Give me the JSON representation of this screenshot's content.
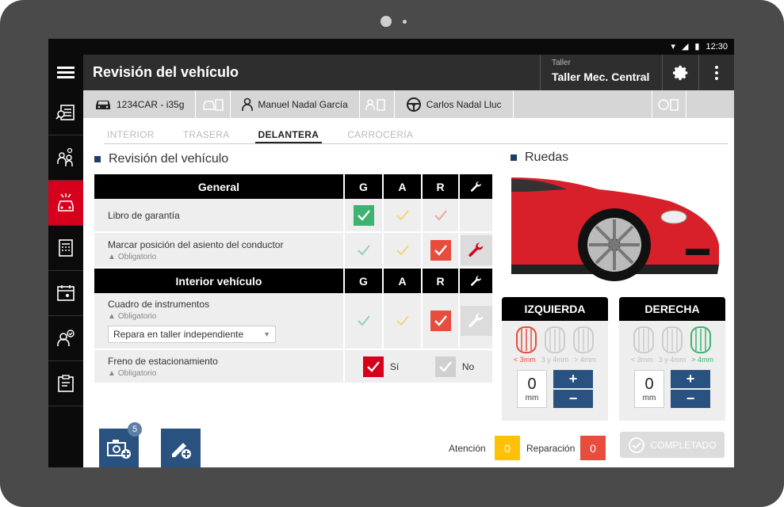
{
  "status_bar": {
    "time": "12:30"
  },
  "app_bar": {
    "title": "Revisión del vehículo",
    "taller_label": "Taller",
    "taller_value": "Taller Mec. Central"
  },
  "info_bar": {
    "plate": "1234CAR - i35g",
    "owner": "Manuel Nadal García",
    "driver": "Carlos Nadal Lluc"
  },
  "tabs": [
    "INTERIOR",
    "TRASERA",
    "DELANTERA",
    "CARROCERÍA"
  ],
  "active_tab": "DELANTERA",
  "review_title": "Revisión del vehículo",
  "wheels_title": "Ruedas",
  "table": {
    "col_g": "G",
    "col_a": "A",
    "col_r": "R",
    "section1": "General",
    "section2": "Interior vehículo",
    "rows": [
      {
        "label": "Libro de garantía",
        "note": "",
        "selected": "G"
      },
      {
        "label": "Marcar posición del asiento del conductor",
        "note": "Obligatorio",
        "selected": "R"
      },
      {
        "label": "Cuadro de instrumentos",
        "note": "Obligatorio",
        "selected": "R",
        "select_value": "Repara en taller independiente"
      },
      {
        "label": "Freno de estacionamiento",
        "note": "Obligatorio",
        "yes": "Sí",
        "no": "No",
        "selected": "Sí"
      }
    ]
  },
  "wheels": {
    "left": {
      "title": "IZQUIERDA",
      "labels": [
        "< 3mm",
        "3 y 4mm",
        "> 4mm"
      ],
      "selected": "< 3mm",
      "value": "0",
      "unit": "mm"
    },
    "right": {
      "title": "DERECHA",
      "labels": [
        "< 3mm",
        "3 y 4mm",
        "> 4mm"
      ],
      "selected": "> 4mm",
      "value": "0",
      "unit": "mm"
    },
    "plus": "+",
    "minus": "−"
  },
  "bottom": {
    "photo_badge": "5",
    "attention_label": "Atención",
    "attention_value": "0",
    "repair_label": "Reparación",
    "repair_value": "0",
    "completed": "COMPLETADO"
  },
  "colors": {
    "accent_red": "#d6001c",
    "navy": "#2a5280",
    "green": "#3cb371",
    "amber": "#ffc107",
    "repair": "#e84c3d"
  }
}
